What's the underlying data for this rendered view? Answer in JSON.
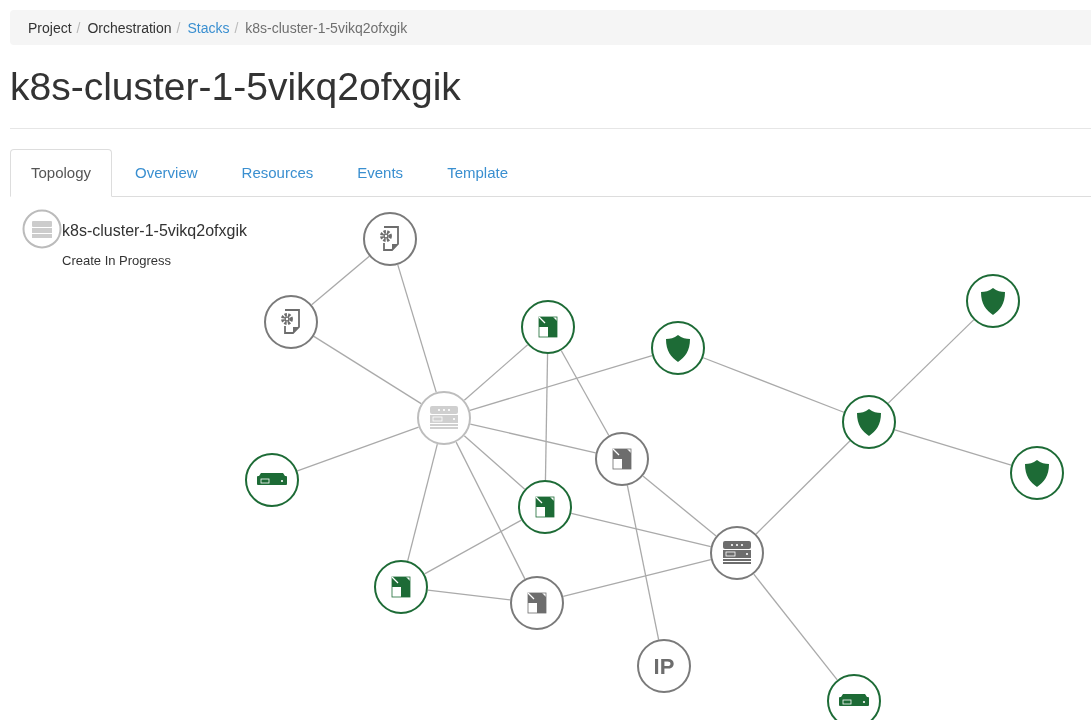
{
  "breadcrumb": {
    "separator": "/",
    "items": [
      {
        "label": "Project",
        "kind": "text"
      },
      {
        "label": "Orchestration",
        "kind": "text"
      },
      {
        "label": "Stacks",
        "kind": "link"
      },
      {
        "label": "k8s-cluster-1-5vikq2ofxgik",
        "kind": "current"
      }
    ]
  },
  "page_title": "k8s-cluster-1-5vikq2ofxgik",
  "tabs": [
    {
      "label": "Topology",
      "selected": true
    },
    {
      "label": "Overview",
      "selected": false
    },
    {
      "label": "Resources",
      "selected": false
    },
    {
      "label": "Events",
      "selected": false
    },
    {
      "label": "Template",
      "selected": false
    }
  ],
  "stack": {
    "name": "k8s-cluster-1-5vikq2ofxgik",
    "status": "Create In Progress"
  },
  "topology": {
    "nodes": [
      {
        "kind": "config",
        "complete": false,
        "pending": false
      },
      {
        "kind": "config",
        "complete": false,
        "pending": false
      },
      {
        "kind": "server",
        "complete": false,
        "pending": true
      },
      {
        "kind": "port",
        "complete": true,
        "pending": false
      },
      {
        "kind": "security_group",
        "complete": true,
        "pending": false
      },
      {
        "kind": "security_group",
        "complete": true,
        "pending": false
      },
      {
        "kind": "security_group",
        "complete": true,
        "pending": false
      },
      {
        "kind": "security_group",
        "complete": true,
        "pending": false
      },
      {
        "kind": "network",
        "complete": true,
        "pending": false
      },
      {
        "kind": "port",
        "complete": false,
        "pending": false
      },
      {
        "kind": "port",
        "complete": true,
        "pending": false
      },
      {
        "kind": "server",
        "complete": false,
        "pending": false
      },
      {
        "kind": "port",
        "complete": true,
        "pending": false
      },
      {
        "kind": "port",
        "complete": false,
        "pending": false
      },
      {
        "kind": "floating_ip",
        "complete": false,
        "pending": false,
        "label": "IP"
      },
      {
        "kind": "network",
        "complete": true,
        "pending": false
      }
    ]
  }
}
